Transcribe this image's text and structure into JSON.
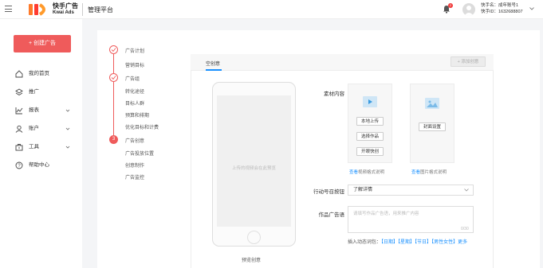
{
  "header": {
    "logo_cn": "快手广告",
    "logo_en": "Kwai Ads",
    "platform_title": "管理平台",
    "notification_count": "2",
    "account_name_label": "快手名：成年账号1",
    "account_id_label": "快手ID：1632688807"
  },
  "sidebar": {
    "create_button": "+ 创建广告",
    "items": [
      {
        "label": "我的首页",
        "icon": "home-icon",
        "has_arrow": false
      },
      {
        "label": "推广",
        "icon": "layers-icon",
        "has_arrow": false
      },
      {
        "label": "报表",
        "icon": "chart-icon",
        "has_arrow": true
      },
      {
        "label": "账户",
        "icon": "user-icon",
        "has_arrow": true
      },
      {
        "label": "工具",
        "icon": "toolbox-icon",
        "has_arrow": true
      },
      {
        "label": "帮助中心",
        "icon": "help-icon",
        "has_arrow": false
      }
    ]
  },
  "steps": [
    {
      "title": "广告计划",
      "state": "done",
      "subs": [
        "营销目标"
      ]
    },
    {
      "title": "广告组",
      "state": "done",
      "subs": [
        "转化途径",
        "目标人群",
        "预算和排期",
        "优化目标和计费"
      ]
    },
    {
      "title": "广告创意",
      "state": "active",
      "number": "3",
      "subs": [
        "广告投放位置",
        "创意制作",
        "广告监控"
      ]
    }
  ],
  "editor": {
    "tab_label": "空创意",
    "add_creative_button": "+ 添加创意",
    "phone_placeholder": "上传的视频会在此预览",
    "preview_label": "预览创意",
    "material_label": "素材内容",
    "video_buttons": [
      "本地上传",
      "选择作品",
      "开眼快创"
    ],
    "video_help_link": "查看",
    "video_help_rest": "视频格式说明",
    "cover_button": "封面设置",
    "cover_help_link": "查看",
    "cover_help_rest": "图片格式说明",
    "action_label": "行动号召按钮",
    "action_value": "了解详情",
    "caption_label": "作品广告语",
    "caption_placeholder": "请填写作品广告语，用来推广内容",
    "char_count": "0/30",
    "insert_prefix": "插入动态词包：",
    "insert_tags": [
      "【日期】",
      "【星期】",
      "【节日】",
      "【男性女性】",
      "更多"
    ]
  }
}
